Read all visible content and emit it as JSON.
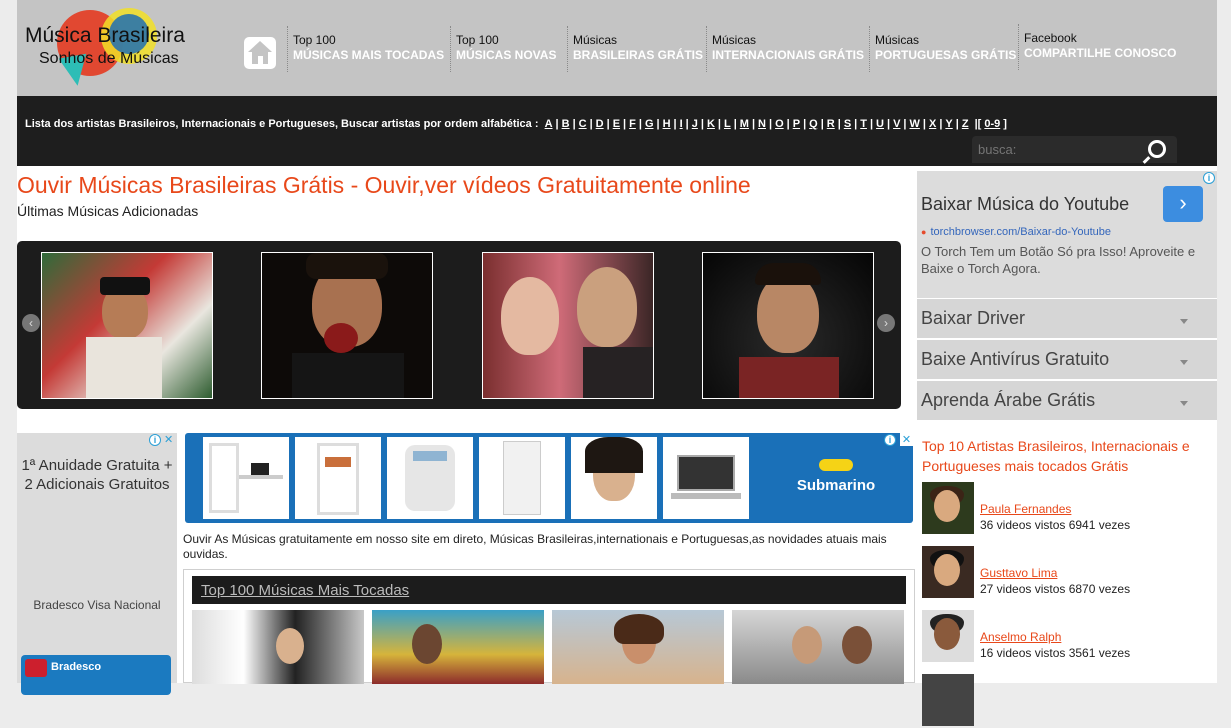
{
  "logo": {
    "line1": "Música Brasileira",
    "line2": "Sonhos de Músicas"
  },
  "nav": [
    {
      "small": "Top 100",
      "big": "MÚSICAS MAIS TOCADAS"
    },
    {
      "small": "Top 100",
      "big": "MÚSICAS NOVAS"
    },
    {
      "small": "Músicas",
      "big": "BRASILEIRAS GRÁTIS"
    },
    {
      "small": "Músicas",
      "big": "INTERNACIONAIS GRÁTIS"
    },
    {
      "small": "Músicas",
      "big": "PORTUGUESAS GRÁTIS"
    },
    {
      "small": "Facebook",
      "big": "COMPARTILHE CONOSCO"
    }
  ],
  "alphabet": {
    "label": "Lista dos artistas Brasileiros, Internacionais e Portugueses, Buscar artistas por ordem alfabética :",
    "letters": [
      "A",
      "B",
      "C",
      "D",
      "E",
      "F",
      "G",
      "H",
      "I",
      "J",
      "K",
      "L",
      "M",
      "N",
      "O",
      "P",
      "Q",
      "R",
      "S",
      "T",
      "U",
      "V",
      "W",
      "X",
      "Y",
      "Z"
    ],
    "digits": "0-9"
  },
  "search": {
    "placeholder": "busca:"
  },
  "main": {
    "title": "Ouvir Músicas Brasileiras Grátis - Ouvir,ver vídeos Gratuitamente online",
    "subtitle": "Últimas Músicas Adicionadas",
    "intro": "Ouvir As Músicas gratuitamente em nosso site em direto, Músicas Brasileiras,internationais e Portuguesas,as novidades atuais mais ouvidas."
  },
  "slider": {
    "prev": "‹",
    "next": "›"
  },
  "sidebar": {
    "ad": {
      "headline": "Baixar Música do Youtube",
      "url": "torchbrowser.com/Baixar-do-Youtube",
      "desc": "O Torch Tem um Botão Só pra Isso! Aproveite e Baixe o Torch Agora.",
      "button": "›"
    },
    "links": [
      "Baixar Driver",
      "Baixe Antivírus Gratuito",
      "Aprenda Árabe Grátis"
    ],
    "top10_title": "Top 10 Artistas Brasileiros, Internacionais e Portugueses mais tocados Grátis",
    "artists": [
      {
        "name": "Paula Fernandes",
        "stats": "36 videos vistos 6941 vezes"
      },
      {
        "name": "Gusttavo Lima",
        "stats": "27 videos vistos 6870 vezes"
      },
      {
        "name": "Anselmo Ralph",
        "stats": "16 videos vistos 3561 vezes"
      }
    ]
  },
  "left_ad": {
    "text": "1ª Anuidade Gratuita + 2 Adicionais Gratuitos",
    "bank": "Bradesco Visa Nacional",
    "card_name": "Bradesco"
  },
  "shop_ad": {
    "brand": "Submarino"
  },
  "top100": {
    "heading": "Top 100 Músicas Mais Tocadas"
  },
  "info_icon": "i",
  "close_icon": "✕"
}
